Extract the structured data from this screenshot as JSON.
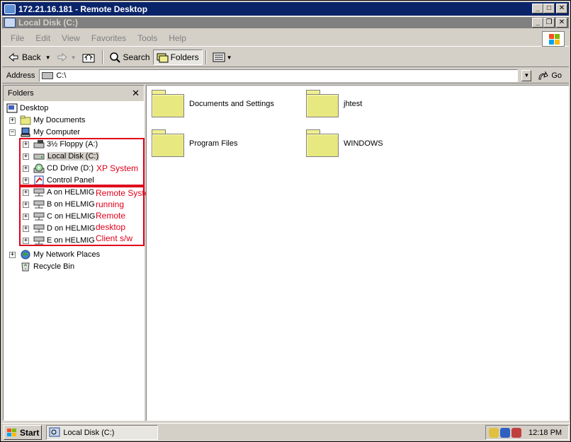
{
  "outer_window": {
    "title": "172.21.16.181 - Remote Desktop"
  },
  "inner_window": {
    "title": "Local Disk (C:)"
  },
  "window_buttons": {
    "minimize": "_",
    "maximize": "□",
    "restore": "❐",
    "close": "✕"
  },
  "menu": [
    "File",
    "Edit",
    "View",
    "Favorites",
    "Tools",
    "Help"
  ],
  "toolbar": {
    "back_label": "Back",
    "search_label": "Search",
    "folders_label": "Folders"
  },
  "address": {
    "label": "Address",
    "value": "C:\\",
    "go_label": "Go"
  },
  "folders_pane": {
    "title": "Folders",
    "close_glyph": "✕"
  },
  "tree": [
    {
      "label": "Desktop",
      "icon": "desktop-icon"
    },
    {
      "label": "My Documents",
      "icon": "folder-icon",
      "expander": "+"
    },
    {
      "label": "My Computer",
      "icon": "computer-icon",
      "expander": "−"
    },
    {
      "label": "3½ Floppy (A:)",
      "icon": "floppy-drive-icon",
      "expander": "+"
    },
    {
      "label": "Local Disk (C:)",
      "icon": "hard-drive-icon",
      "expander": "+",
      "selected": true
    },
    {
      "label": "CD Drive (D:)",
      "icon": "cd-drive-icon",
      "expander": "+"
    },
    {
      "label": "Control Panel",
      "icon": "control-panel-icon",
      "expander": "+"
    },
    {
      "label": "A on HELMIG",
      "icon": "network-drive-icon",
      "expander": "+"
    },
    {
      "label": "B on HELMIG",
      "icon": "network-drive-icon",
      "expander": "+"
    },
    {
      "label": "C on HELMIG",
      "icon": "network-drive-icon",
      "expander": "+"
    },
    {
      "label": "D on HELMIG",
      "icon": "network-drive-icon",
      "expander": "+"
    },
    {
      "label": "E on HELMIG",
      "icon": "network-drive-icon",
      "expander": "+"
    },
    {
      "label": "My Network Places",
      "icon": "network-places-icon",
      "expander": "+"
    },
    {
      "label": "Recycle Bin",
      "icon": "recycle-bin-icon"
    }
  ],
  "annotations": {
    "xp_system": "XP System",
    "remote_lines": [
      "Remote System",
      "running",
      "Remote",
      "desktop",
      "Client s/w"
    ],
    "color": "#e0001a"
  },
  "content": {
    "items": [
      {
        "label": "Documents and Settings",
        "icon": "folder-icon"
      },
      {
        "label": "jhtest",
        "icon": "folder-icon"
      },
      {
        "label": "Program Files",
        "icon": "folder-icon"
      },
      {
        "label": "WINDOWS",
        "icon": "folder-icon"
      }
    ]
  },
  "taskbar": {
    "start_label": "Start",
    "task_label": "Local Disk (C:)",
    "clock": "12:18 PM"
  },
  "colors": {
    "title_active": "#0a246a",
    "title_inactive": "#808080",
    "face": "#d4d0c8",
    "folder": "#e8e880"
  }
}
